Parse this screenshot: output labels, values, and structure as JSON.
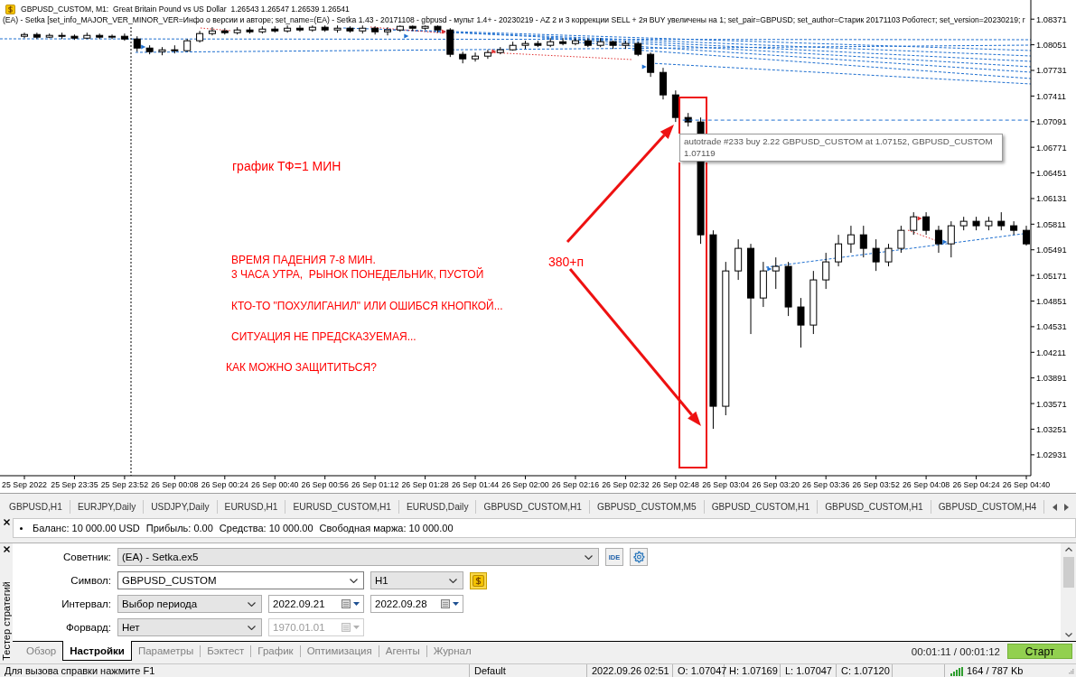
{
  "chart": {
    "header": [
      "GBPUSD_CUSTOM, M1:  Great Britain Pound vs US Dollar  1.26543 1.26547 1.26539 1.26541",
      "(EA) - Setka [set_info_MAJOR_VER_MINOR_VER=Инфо о версии и авторе; set_name=(EA) - Setka 1.43 - 20171108 - gbpusd - мульт 1.4+ - 20230219 - AZ 2 и 3 коррекции SELL + 2я BUY увеличены на 1; set_pair=GBPUSD; set_author=Старик 20171103 Роботест; set_version=20230219; r"
    ],
    "tooltip": [
      "autotrade #233 buy 2.22 GBPUSD_CUSTOM at 1.07152, GBPUSD_CUSTOM",
      "1.07119"
    ],
    "chart_data": [
      {
        "type": "candlestick",
        "categories": [
          "25 Sep 2022",
          null,
          null,
          null,
          "25 Sep 23:35",
          null,
          null,
          null,
          "25 Sep 23:52",
          null,
          null,
          null,
          "26 Sep 00:08",
          null,
          null,
          null,
          "26 Sep 00:24",
          null,
          null,
          null,
          "26 Sep 00:40",
          null,
          null,
          null,
          "26 Sep 00:56",
          null,
          null,
          null,
          "26 Sep 01:12",
          null,
          null,
          null,
          "26 Sep 01:28",
          null,
          null,
          null,
          "26 Sep 01:44",
          null,
          null,
          null,
          "26 Sep 02:00",
          null,
          null,
          null,
          "26 Sep 02:16",
          null,
          null,
          null,
          "26 Sep 02:32",
          null,
          null,
          null,
          "26 Sep 02:48",
          null,
          null,
          null,
          "26 Sep 03:04",
          null,
          null,
          null,
          "26 Sep 03:20",
          null,
          null,
          null,
          "26 Sep 03:36",
          null,
          null,
          null,
          "26 Sep 03:52",
          null,
          null,
          null,
          "26 Sep 04:08",
          null,
          null,
          null,
          "26 Sep 04:24",
          null,
          null,
          null,
          "26 Sep 04:40"
        ],
        "ohlc": [
          [
            1.08157,
            1.08202,
            1.08134,
            1.08179
          ],
          [
            1.08179,
            1.08202,
            1.08123,
            1.08146
          ],
          [
            1.08146,
            1.08191,
            1.08134,
            1.08168
          ],
          [
            1.08168,
            1.08202,
            1.08123,
            1.08157
          ],
          [
            1.08157,
            1.08179,
            1.08112,
            1.08134
          ],
          [
            1.08134,
            1.08202,
            1.08123,
            1.08168
          ],
          [
            1.08168,
            1.08191,
            1.08123,
            1.08146
          ],
          [
            1.08146,
            1.08179,
            1.08123,
            1.08157
          ],
          [
            1.08157,
            1.08191,
            1.08101,
            1.08123
          ],
          [
            1.08123,
            1.08157,
            1.07965,
            1.0801
          ],
          [
            1.0801,
            1.08044,
            1.07932,
            1.07965
          ],
          [
            1.07965,
            1.08022,
            1.0792,
            1.07988
          ],
          [
            1.07988,
            1.08044,
            1.07943,
            1.07977
          ],
          [
            1.07977,
            1.08123,
            1.07965,
            1.08101
          ],
          [
            1.08101,
            1.08224,
            1.08078,
            1.08191
          ],
          [
            1.08191,
            1.0827,
            1.08168,
            1.08224
          ],
          [
            1.08224,
            1.08258,
            1.08179,
            1.08202
          ],
          [
            1.08202,
            1.0827,
            1.08179,
            1.08236
          ],
          [
            1.08236,
            1.0827,
            1.08191,
            1.08213
          ],
          [
            1.08213,
            1.08281,
            1.08191,
            1.08247
          ],
          [
            1.08247,
            1.08281,
            1.08202,
            1.08224
          ],
          [
            1.08224,
            1.08292,
            1.08202,
            1.08258
          ],
          [
            1.08258,
            1.08292,
            1.08213,
            1.08236
          ],
          [
            1.08236,
            1.08292,
            1.08213,
            1.0827
          ],
          [
            1.0827,
            1.08292,
            1.08213,
            1.08236
          ],
          [
            1.08236,
            1.08292,
            1.08202,
            1.08258
          ],
          [
            1.08258,
            1.08281,
            1.08202,
            1.08224
          ],
          [
            1.08224,
            1.08292,
            1.08191,
            1.08258
          ],
          [
            1.08258,
            1.08281,
            1.08179,
            1.08213
          ],
          [
            1.08213,
            1.0827,
            1.08168,
            1.08236
          ],
          [
            1.08236,
            1.08292,
            1.08213,
            1.08281
          ],
          [
            1.08281,
            1.08292,
            1.08224,
            1.08258
          ],
          [
            1.08258,
            1.08292,
            1.08236,
            1.08281
          ],
          [
            1.08281,
            1.08292,
            1.08202,
            1.08236
          ],
          [
            1.08236,
            1.08258,
            1.07898,
            1.07932
          ],
          [
            1.07932,
            1.07965,
            1.07819,
            1.07875
          ],
          [
            1.07875,
            1.07954,
            1.07841,
            1.07909
          ],
          [
            1.07909,
            1.07988,
            1.07875,
            1.07954
          ],
          [
            1.07954,
            1.08022,
            1.07932,
            1.07988
          ],
          [
            1.07988,
            1.08089,
            1.07977,
            1.08044
          ],
          [
            1.08044,
            1.08101,
            1.07999,
            1.08067
          ],
          [
            1.08067,
            1.08101,
            1.08022,
            1.08044
          ],
          [
            1.08044,
            1.08134,
            1.08022,
            1.08089
          ],
          [
            1.08089,
            1.08134,
            1.08044,
            1.08067
          ],
          [
            1.08067,
            1.08134,
            1.08044,
            1.08101
          ],
          [
            1.08101,
            1.08134,
            1.08022,
            1.08044
          ],
          [
            1.08044,
            1.08134,
            1.08022,
            1.08089
          ],
          [
            1.08089,
            1.08101,
            1.07999,
            1.08044
          ],
          [
            1.08044,
            1.08101,
            1.07999,
            1.08067
          ],
          [
            1.08067,
            1.08089,
            1.07909,
            1.07932
          ],
          [
            1.07932,
            1.07954,
            1.0765,
            1.07706
          ],
          [
            1.07706,
            1.07763,
            1.07368,
            1.07425
          ],
          [
            1.07425,
            1.07481,
            1.07087,
            1.07143
          ],
          [
            1.07143,
            1.07199,
            1.0703,
            1.07087
          ],
          [
            1.07087,
            1.07143,
            1.05565,
            1.05678
          ],
          [
            1.05678,
            1.05734,
            1.03255,
            1.03537
          ],
          [
            1.03537,
            1.0534,
            1.03425,
            1.05227
          ],
          [
            1.05227,
            1.05622,
            1.05115,
            1.05509
          ],
          [
            1.05509,
            1.05565,
            1.04439,
            1.04889
          ],
          [
            1.04889,
            1.0534,
            1.04777,
            1.05227
          ],
          [
            1.05227,
            1.05396,
            1.05002,
            1.05284
          ],
          [
            1.05284,
            1.0534,
            1.04664,
            1.04777
          ],
          [
            1.04777,
            1.04889,
            1.0427,
            1.04551
          ],
          [
            1.04551,
            1.05227,
            1.04439,
            1.05115
          ],
          [
            1.05115,
            1.05453,
            1.05002,
            1.0534
          ],
          [
            1.0534,
            1.05678,
            1.05284,
            1.05565
          ],
          [
            1.05565,
            1.05791,
            1.05453,
            1.05678
          ],
          [
            1.05678,
            1.05791,
            1.05396,
            1.05509
          ],
          [
            1.05509,
            1.05622,
            1.05227,
            1.0534
          ],
          [
            1.0534,
            1.05565,
            1.05284,
            1.05509
          ],
          [
            1.05509,
            1.05791,
            1.05453,
            1.05734
          ],
          [
            1.05734,
            1.0596,
            1.05678,
            1.05903
          ],
          [
            1.05903,
            1.0596,
            1.05678,
            1.05734
          ],
          [
            1.05734,
            1.05791,
            1.05453,
            1.05565
          ],
          [
            1.05565,
            1.05847,
            1.05396,
            1.05791
          ],
          [
            1.05791,
            1.05903,
            1.05734,
            1.05847
          ],
          [
            1.05847,
            1.05903,
            1.05734,
            1.05791
          ],
          [
            1.05791,
            1.05903,
            1.05734,
            1.05847
          ],
          [
            1.05847,
            1.0596,
            1.05734,
            1.05791
          ],
          [
            1.05791,
            1.05847,
            1.05678,
            1.05734
          ],
          [
            1.05734,
            1.05791,
            1.05543,
            1.05565
          ]
        ],
        "ylim": [
          1.0267,
          1.0861
        ],
        "yticks": [
          1.08371,
          1.08051,
          1.07731,
          1.07411,
          1.07091,
          1.06771,
          1.06451,
          1.06131,
          1.05811,
          1.05491,
          1.05171,
          1.04851,
          1.04531,
          1.04211,
          1.03891,
          1.03571,
          1.03251,
          1.02931
        ],
        "ref_lines": [
          {
            "axis": "y",
            "value": 1.0711,
            "color": "#1e6fd0",
            "line_style": "dashed"
          }
        ],
        "annotations": [
          "график ТФ=1 МИН",
          "ВРЕМЯ ПАДЕНИЯ 7-8 МИН.",
          "3 ЧАСА УТРА,  РЫНОК ПОНЕДЕЛЬНИК, ПУСТОЙ",
          "КТО-ТО \"ПОХУЛИГАНИЛ\" ИЛИ ОШИБСЯ КНОПКОЙ...",
          "СИТУАЦИЯ НЕ ПРЕДСКАЗУЕМАЯ...",
          "КАК МОЖНО ЗАЩИТИТЬСЯ?",
          "380+п"
        ]
      }
    ]
  },
  "chart_tabs": [
    {
      "label": "GBPUSD,H1",
      "selected": false
    },
    {
      "label": "EURJPY,Daily",
      "selected": false
    },
    {
      "label": "USDJPY,Daily",
      "selected": false
    },
    {
      "label": "EURUSD,H1",
      "selected": false
    },
    {
      "label": "EURUSD_CUSTOM,H1",
      "selected": false
    },
    {
      "label": "EURUSD,Daily",
      "selected": false
    },
    {
      "label": "GBPUSD_CUSTOM,H1",
      "selected": false
    },
    {
      "label": "GBPUSD_CUSTOM,M5",
      "selected": false
    },
    {
      "label": "GBPUSD_CUSTOM,H1",
      "selected": false
    },
    {
      "label": "GBPUSD_CUSTOM,H1",
      "selected": false
    },
    {
      "label": "GBPUSD_CUSTOM,H4",
      "selected": false
    }
  ],
  "toolbox": {
    "summary": [
      "Баланс: 10 000.00 USD",
      "Прибыль: 0.00",
      "Средства: 10 000.00",
      "Свободная маржа: 10 000.00"
    ]
  },
  "tester": {
    "side_label": "Тестер стратегий",
    "rows": [
      {
        "label": "Советник:",
        "controls": [
          {
            "kind": "combo",
            "value": "(EA) - Setka.ex5"
          },
          {
            "kind": "text_button",
            "text": "IDE"
          },
          {
            "kind": "gear_button"
          }
        ]
      },
      {
        "label": "Символ:",
        "controls": [
          {
            "kind": "edit_combo",
            "value": "GBPUSD_CUSTOM"
          },
          {
            "kind": "combo",
            "value": "H1"
          },
          {
            "kind": "dollar_button"
          }
        ]
      },
      {
        "label": "Интервал:",
        "controls": [
          {
            "kind": "combo",
            "value": "Выбор периода"
          },
          {
            "kind": "date",
            "value": "2022.09.21",
            "disabled": false
          },
          {
            "kind": "date",
            "value": "2022.09.28",
            "disabled": false
          }
        ]
      },
      {
        "label": "Форвард:",
        "controls": [
          {
            "kind": "combo",
            "value": "Нет"
          },
          {
            "kind": "date",
            "value": "1970.01.01",
            "disabled": true
          }
        ]
      }
    ],
    "tabs": [
      {
        "label": "Обзор",
        "selected": false
      },
      {
        "label": "Настройки",
        "selected": true
      },
      {
        "label": "Параметры",
        "selected": false
      },
      {
        "label": "Бэктест",
        "selected": false
      },
      {
        "label": "График",
        "selected": false
      },
      {
        "label": "Оптимизация",
        "selected": false
      },
      {
        "label": "Агенты",
        "selected": false
      },
      {
        "label": "Журнал",
        "selected": false
      }
    ],
    "elapsed": "00:01:11 / 00:01:12",
    "start_button": "Старт"
  },
  "status_bar": {
    "help": "Для вызова справки нажмите F1",
    "profile": "Default",
    "datetime": "2022.09.26 02:51",
    "open": "O: 1.07047",
    "high": "H: 1.07169",
    "low": "L: 1.07047",
    "close": "C: 1.07120",
    "traffic": "164 / 787 Kb"
  }
}
